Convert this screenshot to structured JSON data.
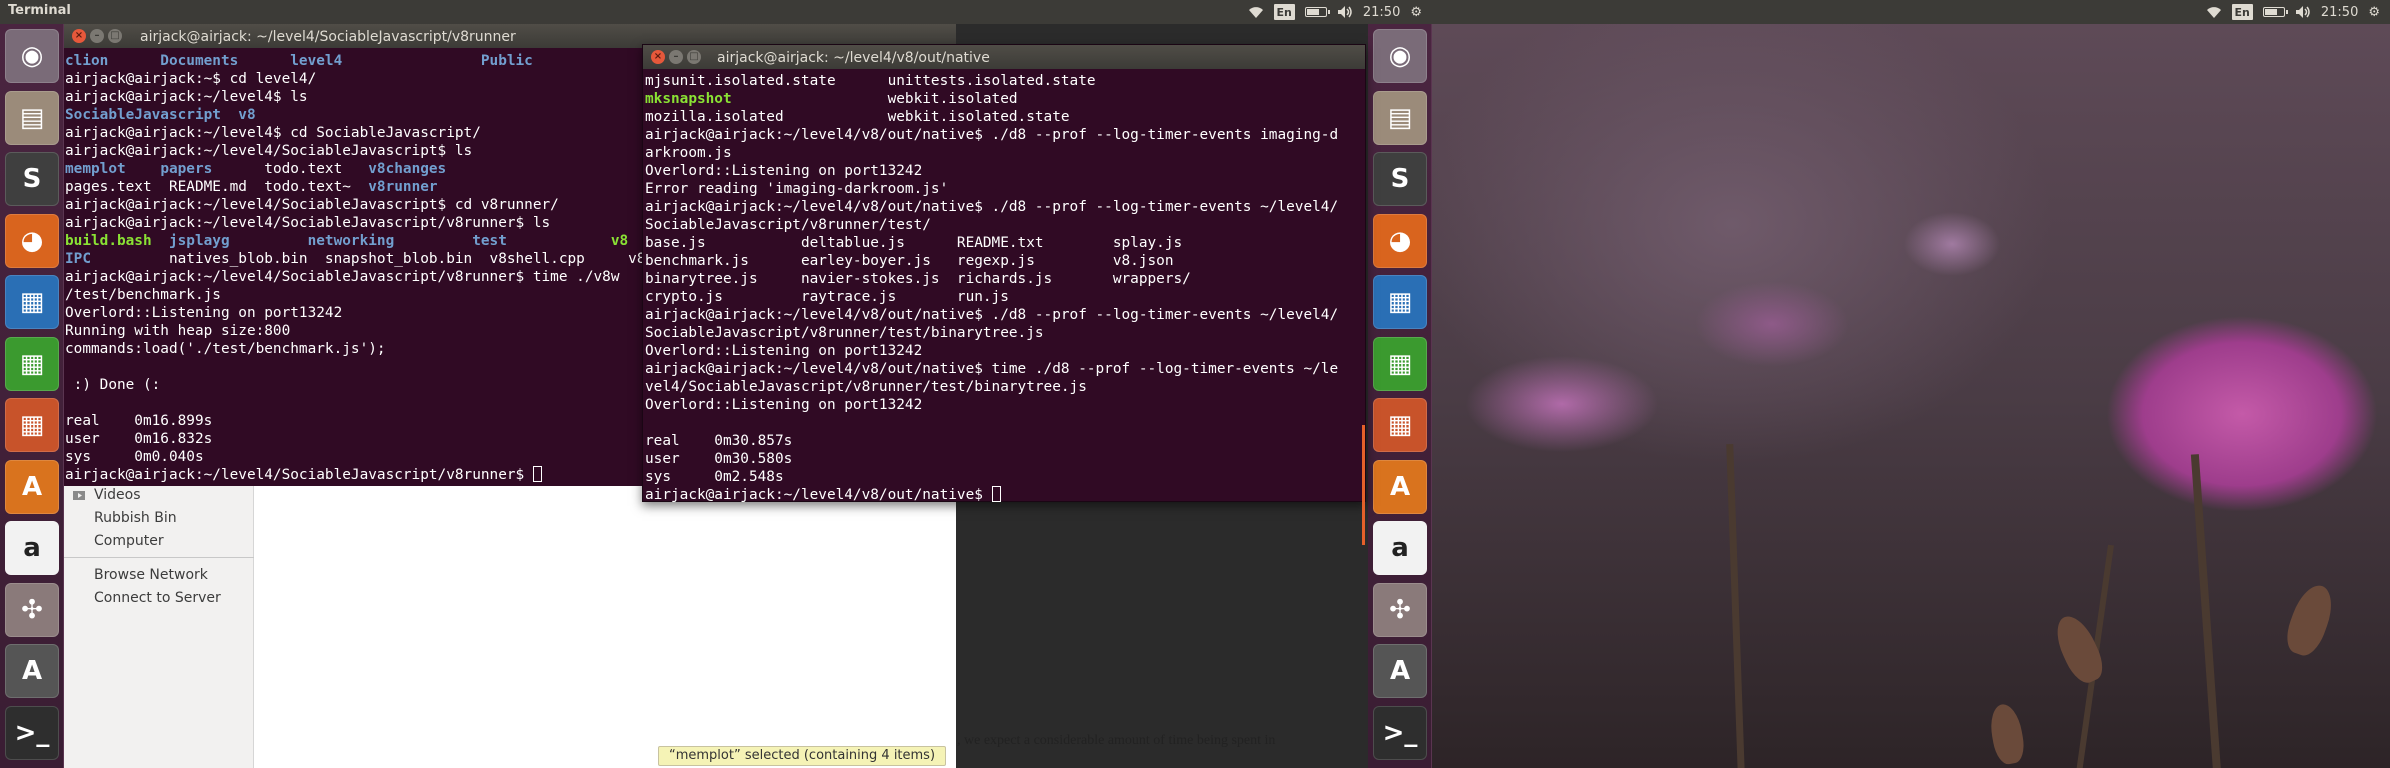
{
  "topbar": {
    "app_title": "Terminal",
    "keyboard_layout": "En",
    "time": "21:50"
  },
  "launcher": {
    "items": [
      {
        "name": "dash-home",
        "glyph": "◉",
        "color": "#7a6b78"
      },
      {
        "name": "files",
        "glyph": "▤",
        "color": "#9b8b7a"
      },
      {
        "name": "sublime-text",
        "glyph": "S",
        "color": "#3f3f3f"
      },
      {
        "name": "firefox",
        "glyph": "◕",
        "color": "#d9641e"
      },
      {
        "name": "libreoffice-writer",
        "glyph": "▦",
        "color": "#2a6fb5"
      },
      {
        "name": "libreoffice-calc",
        "glyph": "▦",
        "color": "#3b9a2f"
      },
      {
        "name": "libreoffice-impress",
        "glyph": "▦",
        "color": "#c8532a"
      },
      {
        "name": "ubuntu-software-center",
        "glyph": "A",
        "color": "#d9731e"
      },
      {
        "name": "amazon",
        "glyph": "a",
        "color": "#f2f2f2"
      },
      {
        "name": "system-settings",
        "glyph": "✣",
        "color": "#8a7a7a"
      },
      {
        "name": "software-updater",
        "glyph": "A",
        "color": "#555555"
      },
      {
        "name": "terminal",
        "glyph": ">_",
        "color": "#2e2e2e"
      }
    ]
  },
  "file_manager": {
    "sidebar": [
      {
        "label": "Videos"
      },
      {
        "label": "Rubbish Bin"
      },
      {
        "label": "Computer"
      },
      {
        "label": "Browse Network"
      },
      {
        "label": "Connect to Server"
      }
    ],
    "status": "“memplot” selected  (containing 4 items)",
    "document_text": ", we expect a considerable amount of time being spent in"
  },
  "terminal1": {
    "title": "airjack@airjack: ~/level4/SociableJavascript/v8runner",
    "lines": [
      "clion      Documents      level4                Public",
      "airjack@airjack:~$ cd level4/",
      "airjack@airjack:~/level4$ ls",
      "SociableJavascript  v8",
      "airjack@airjack:~/level4$ cd SociableJavascript/",
      "airjack@airjack:~/level4/SociableJavascript$ ls",
      "memplot    papers      todo.text   v8changes",
      "pages.text  README.md  todo.text~  v8runner",
      "airjack@airjack:~/level4/SociableJavascript$ cd v8runner/",
      "airjack@airjack:~/level4/SociableJavascript/v8runner$ ls",
      "build.bash  jsplayg         networking         test            v8",
      "IPC         natives_blob.bin  snapshot_blob.bin  v8shell.cpp     v8",
      "airjack@airjack:~/level4/SociableJavascript/v8runner$ time ./v8w",
      "/test/benchmark.js",
      "Overlord::Listening on port13242",
      "Running with heap size:800",
      "commands:load('./test/benchmark.js');",
      "",
      " :) Done (:",
      "",
      "real    0m16.899s",
      "user    0m16.832s",
      "sys     0m0.040s",
      "airjack@airjack:~/level4/SociableJavascript/v8runner$ "
    ]
  },
  "terminal2": {
    "title": "airjack@airjack: ~/level4/v8/out/native",
    "lines": [
      "mjsunit.isolated.state      unittests.isolated.state",
      "mksnapshot                  webkit.isolated",
      "mozilla.isolated            webkit.isolated.state",
      "airjack@airjack:~/level4/v8/out/native$ ./d8 --prof --log-timer-events imaging-d",
      "arkroom.js",
      "Overlord::Listening on port13242",
      "Error reading 'imaging-darkroom.js'",
      "airjack@airjack:~/level4/v8/out/native$ ./d8 --prof --log-timer-events ~/level4/",
      "SociableJavascript/v8runner/test/",
      "base.js           deltablue.js      README.txt        splay.js",
      "benchmark.js      earley-boyer.js   regexp.js         v8.json",
      "binarytree.js     navier-stokes.js  richards.js       wrappers/",
      "crypto.js         raytrace.js       run.js",
      "airjack@airjack:~/level4/v8/out/native$ ./d8 --prof --log-timer-events ~/level4/",
      "SociableJavascript/v8runner/test/binarytree.js",
      "Overlord::Listening on port13242",
      "airjack@airjack:~/level4/v8/out/native$ time ./d8 --prof --log-timer-events ~/le",
      "vel4/SociableJavascript/v8runner/test/binarytree.js",
      "Overlord::Listening on port13242",
      "",
      "real    0m30.857s",
      "user    0m30.580s",
      "sys     0m2.548s",
      "airjack@airjack:~/level4/v8/out/native$ "
    ]
  }
}
